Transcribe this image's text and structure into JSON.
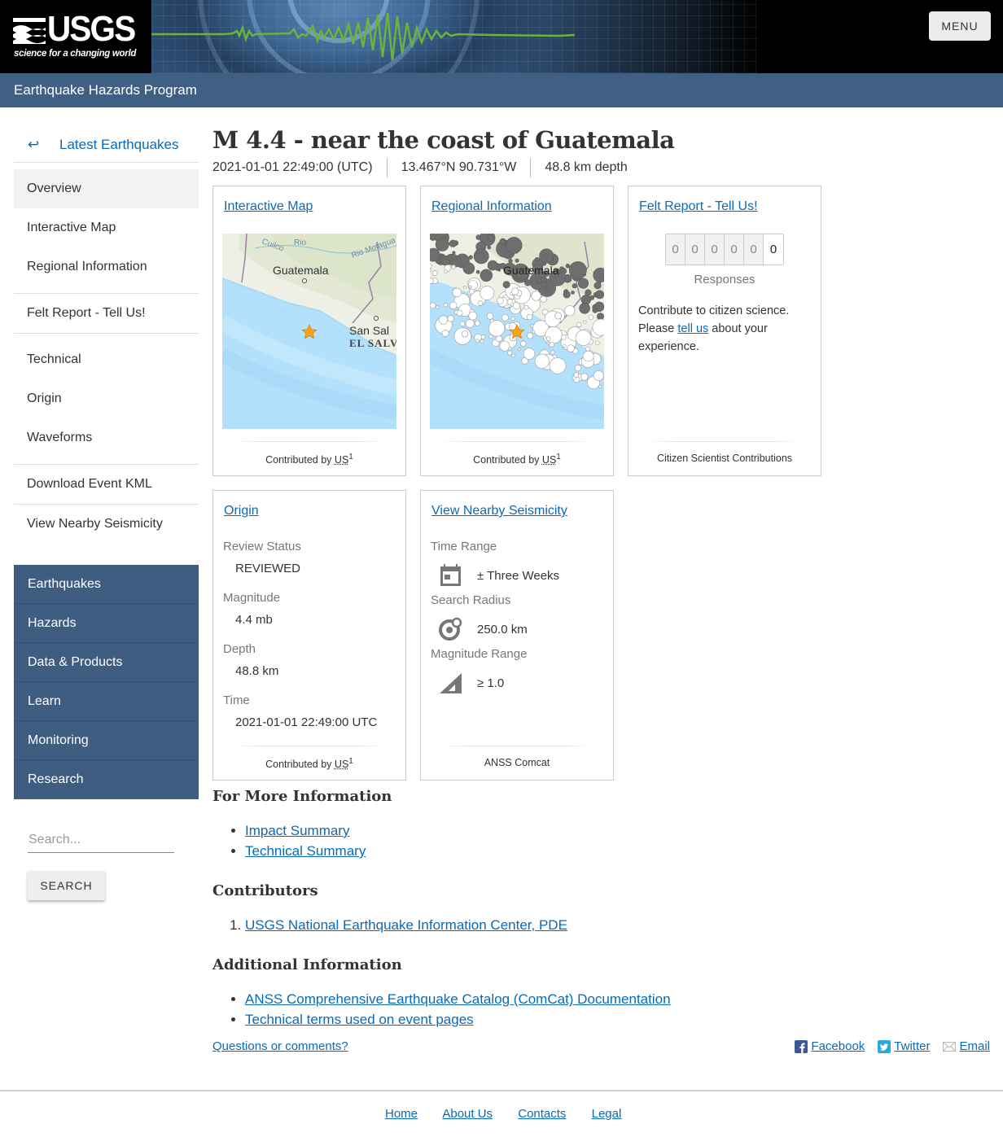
{
  "header": {
    "logo_text": "USGS",
    "logo_tagline": "science for a changing world",
    "menu_label": "MENU",
    "program_title": "Earthquake Hazards Program"
  },
  "sidebar": {
    "back_link": {
      "icon": "return-arrow-icon",
      "arrow_glyph": "↩",
      "label": "Latest Earthquakes"
    },
    "groups": [
      [
        {
          "label": "Overview",
          "active": true
        },
        {
          "label": "Interactive Map"
        },
        {
          "label": "Regional Information"
        }
      ],
      [
        {
          "label": "Felt Report - Tell Us!"
        }
      ],
      [
        {
          "label": "Technical"
        },
        {
          "label": "Origin"
        },
        {
          "label": "Waveforms"
        }
      ],
      [
        {
          "label": "Download Event KML"
        }
      ],
      [
        {
          "label": "View Nearby Seismicity"
        }
      ]
    ],
    "section_nav": [
      "Earthquakes",
      "Hazards",
      "Data & Products",
      "Learn",
      "Monitoring",
      "Research"
    ],
    "search": {
      "placeholder": "Search...",
      "value": "",
      "button_label": "SEARCH"
    }
  },
  "event": {
    "title": "M 4.4 - near the coast of Guatemala",
    "time": "2021-01-01 22:49:00 (UTC)",
    "location": "13.467°N 90.731°W",
    "depth": "48.8 km depth"
  },
  "cards": {
    "interactive_map": {
      "title": "Interactive Map",
      "map_labels": {
        "city": "Guatemala",
        "city2": "San Sal",
        "country": "EL SALV",
        "river1": "Cuilco",
        "river2": "Rio",
        "river3": "Rio Motagua"
      },
      "footer_prefix": "Contributed by",
      "contributor": "US",
      "contributor_ref": "1"
    },
    "regional_info": {
      "title": "Regional Information",
      "map_label": "Guatemala",
      "footer_prefix": "Contributed by",
      "contributor": "US",
      "contributor_ref": "1"
    },
    "felt_report": {
      "title": "Felt Report - Tell Us!",
      "counter_digits": [
        "0",
        "0",
        "0",
        "0",
        "0",
        "0"
      ],
      "responses_label": "Responses",
      "text_before": "Contribute to citizen science. Please ",
      "link_text": "tell us",
      "text_after": " about your experience.",
      "footer": "Citizen Scientist Contributions"
    },
    "origin": {
      "title": "Origin",
      "fields": [
        {
          "label": "Review Status",
          "value": "REVIEWED"
        },
        {
          "label": "Magnitude",
          "value": "4.4 mb"
        },
        {
          "label": "Depth",
          "value": "48.8 km"
        },
        {
          "label": "Time",
          "value": "2021-01-01 22:49:00 UTC"
        }
      ],
      "footer_prefix": "Contributed by",
      "contributor": "US",
      "contributor_ref": "1"
    },
    "nearby_seismicity": {
      "title": "View Nearby Seismicity",
      "params": [
        {
          "label": "Time Range",
          "icon": "calendar-icon",
          "value": "± Three Weeks"
        },
        {
          "label": "Search Radius",
          "icon": "radius-icon",
          "value": "250.0 km"
        },
        {
          "label": "Magnitude Range",
          "icon": "magnitude-ramp-icon",
          "value": "≥ 1.0"
        }
      ],
      "footer": "ANSS Comcat"
    }
  },
  "more_info": {
    "heading": "For More Information",
    "links": [
      "Impact Summary",
      "Technical Summary"
    ]
  },
  "contributors": {
    "heading": "Contributors",
    "items": [
      "USGS National Earthquake Information Center, PDE"
    ]
  },
  "additional_info": {
    "heading": "Additional Information",
    "links": [
      "ANSS Comprehensive Earthquake Catalog (ComCat) Documentation",
      "Technical terms used on event pages"
    ]
  },
  "page_footer": {
    "questions_link": "Questions or comments?",
    "social": [
      {
        "label": "Facebook",
        "icon": "facebook-icon",
        "color": "#3b5998"
      },
      {
        "label": "Twitter",
        "icon": "twitter-icon",
        "color": "#2aa9e0"
      },
      {
        "label": "Email",
        "icon": "email-icon",
        "color": "#cccccc"
      }
    ],
    "site_links": [
      "Home",
      "About Us",
      "Contacts",
      "Legal"
    ]
  },
  "colors": {
    "link": "#0b69b7",
    "program_bar": "#3f6083",
    "section_nav": "#3e5d80",
    "seismogram": "#6bb33a",
    "epicenter_star": "#f7a21b"
  }
}
